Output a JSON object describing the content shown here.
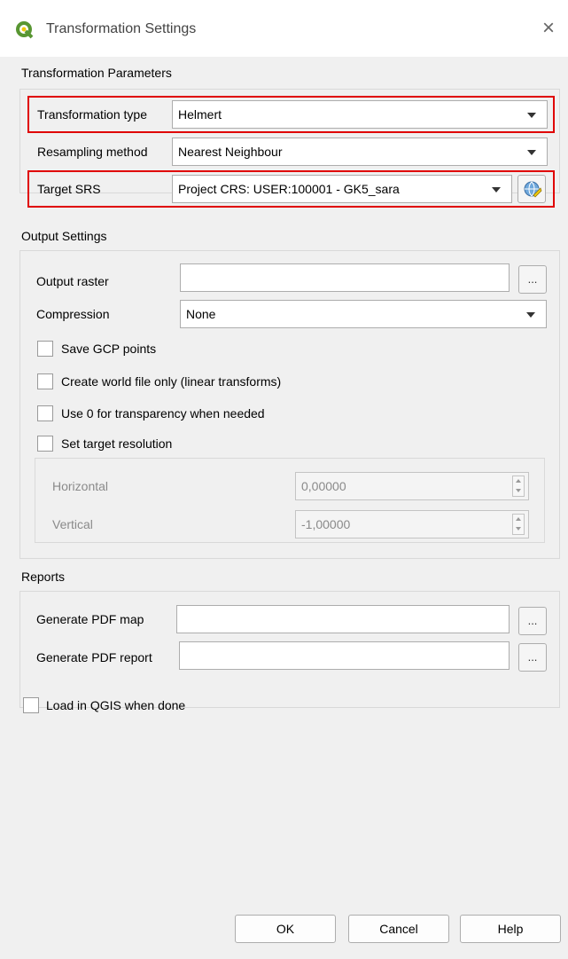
{
  "window": {
    "title": "Transformation Settings",
    "close_glyph": "×",
    "app_icon": "qgis-logo-icon"
  },
  "transformation_parameters": {
    "heading": "Transformation Parameters",
    "transformation_type": {
      "label": "Transformation type",
      "value": "Helmert"
    },
    "resampling_method": {
      "label": "Resampling method",
      "value": "Nearest Neighbour"
    },
    "target_srs": {
      "label": "Target SRS",
      "value": "Project CRS: USER:100001 - GK5_sara",
      "button_icon": "crs-selector-icon"
    }
  },
  "output_settings": {
    "heading": "Output Settings",
    "output_raster": {
      "label": "Output raster",
      "value": "",
      "browse": "..."
    },
    "compression": {
      "label": "Compression",
      "value": "None"
    },
    "save_gcp_points": {
      "label": "Save GCP points",
      "checked": false
    },
    "create_world_file": {
      "label": "Create world file only (linear transforms)",
      "checked": false
    },
    "use_zero_transparency": {
      "label": "Use 0 for transparency when needed",
      "checked": false
    },
    "set_target_resolution": {
      "label": "Set target resolution",
      "checked": false
    },
    "horizontal": {
      "label": "Horizontal",
      "value": "0,00000"
    },
    "vertical": {
      "label": "Vertical",
      "value": "-1,00000"
    }
  },
  "reports": {
    "heading": "Reports",
    "pdf_map": {
      "label": "Generate PDF map",
      "value": "",
      "browse": "..."
    },
    "pdf_report": {
      "label": "Generate PDF report",
      "value": "",
      "browse": "..."
    }
  },
  "load_in_qgis": {
    "label": "Load in QGIS when done",
    "checked": false
  },
  "buttons": {
    "ok": "OK",
    "cancel": "Cancel",
    "help": "Help"
  },
  "colors": {
    "highlight": "#e00000",
    "qgis_green": "#589632",
    "qgis_yellow": "#eec90d"
  }
}
